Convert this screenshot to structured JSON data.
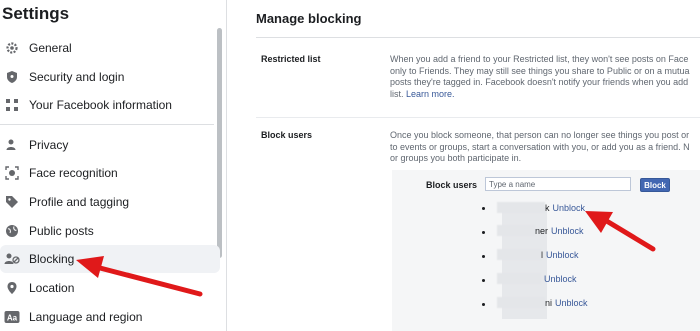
{
  "sidebar": {
    "title": "Settings",
    "items": [
      {
        "label": "General",
        "icon": "gear-icon"
      },
      {
        "label": "Security and login",
        "icon": "shield-icon"
      },
      {
        "label": "Your Facebook information",
        "icon": "grid-icon"
      },
      {
        "label": "Privacy",
        "icon": "person-lock-icon"
      },
      {
        "label": "Face recognition",
        "icon": "face-icon"
      },
      {
        "label": "Profile and tagging",
        "icon": "tag-icon"
      },
      {
        "label": "Public posts",
        "icon": "globe-icon"
      },
      {
        "label": "Blocking",
        "icon": "blocking-icon"
      },
      {
        "label": "Location",
        "icon": "location-pin-icon"
      },
      {
        "label": "Language and region",
        "icon": "language-icon"
      }
    ]
  },
  "main": {
    "title": "Manage blocking",
    "restricted": {
      "label": "Restricted list",
      "lines": [
        "When you add a friend to your Restricted list, they won't see posts on Face",
        "only to Friends. They may still see things you share to Public or on a mutua",
        "posts they're tagged in. Facebook doesn't notify your friends when you add",
        "list."
      ],
      "link": "Learn more."
    },
    "block_users": {
      "label": "Block users",
      "lines": [
        "Once you block someone, that person can no longer see things you post or",
        "to events or groups, start a conversation with you, or add you as a friend. N",
        "or groups you both participate in."
      ],
      "field_label": "Block users",
      "input_placeholder": "Type a name",
      "button_label": "Block",
      "blocked": [
        {
          "name_suffix": "k",
          "action": "Unblock"
        },
        {
          "name_suffix": "ner",
          "action": "Unblock"
        },
        {
          "name_suffix": "l",
          "action": "Unblock"
        },
        {
          "name_suffix": "",
          "action": "Unblock"
        },
        {
          "name_suffix": "ni",
          "action": "Unblock"
        }
      ]
    }
  },
  "colors": {
    "accent": "#4267b2",
    "link": "#385898",
    "arrow": "#e0191a"
  }
}
